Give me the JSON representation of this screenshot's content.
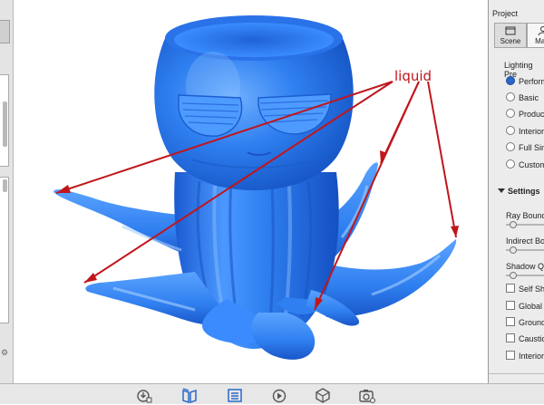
{
  "viewport": {
    "annotation_text": "liquid",
    "model": "blue octopus cup"
  },
  "right_panel": {
    "title": "Project",
    "tabs": [
      {
        "label": "Scene",
        "icon": "scene-icon",
        "active": true
      },
      {
        "label": "Mate",
        "icon": "person-icon",
        "active": false
      }
    ],
    "lighting_title": "Lighting Pre",
    "lighting_options": [
      {
        "label": "Perform",
        "selected": true
      },
      {
        "label": "Basic",
        "selected": false
      },
      {
        "label": "Product",
        "selected": false
      },
      {
        "label": "Interior",
        "selected": false
      },
      {
        "label": "Full Sim",
        "selected": false
      },
      {
        "label": "Custom",
        "selected": false
      }
    ],
    "settings_title": "Settings",
    "sliders": [
      {
        "label": "Ray Bounce"
      },
      {
        "label": "Indirect Bou"
      },
      {
        "label": "Shadow Qu"
      }
    ],
    "checkboxes": [
      {
        "label": "Self Sha"
      },
      {
        "label": "Global I"
      },
      {
        "label": "Ground"
      },
      {
        "label": "Caustic"
      },
      {
        "label": "Interior"
      }
    ]
  },
  "bottom_toolbar": {
    "buttons": [
      "import-icon",
      "library-icon",
      "project-icon",
      "animation-icon",
      "render-icon",
      "screenshot-icon"
    ]
  },
  "colors": {
    "model_blue": "#2f7ff0",
    "annotation_red": "#c0161b",
    "accent": "#2a66c9"
  }
}
